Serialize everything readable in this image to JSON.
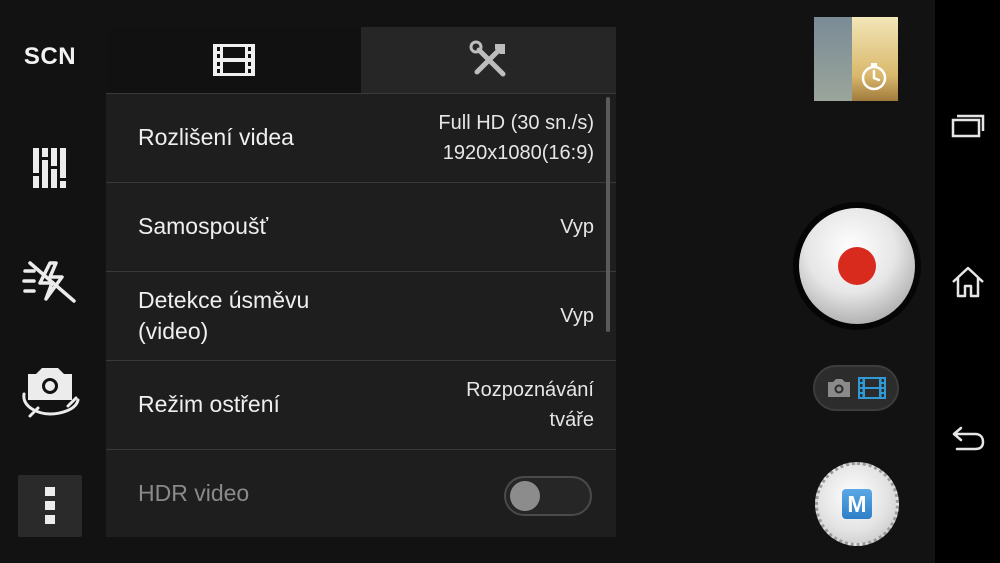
{
  "left_rail": {
    "scene_label": "SCN",
    "items": [
      {
        "name": "scene-button",
        "icon": "scn-text"
      },
      {
        "name": "adjustments-button",
        "icon": "sliders-icon"
      },
      {
        "name": "flash-button",
        "icon": "flash-off-icon"
      },
      {
        "name": "switch-camera-button",
        "icon": "camera-switch-icon"
      },
      {
        "name": "more-options-button",
        "icon": "more-vertical-icon"
      }
    ]
  },
  "settings_panel": {
    "tabs": [
      {
        "name": "video-settings",
        "icon": "film-strip-icon",
        "active": true
      },
      {
        "name": "general-settings",
        "icon": "tools-icon",
        "active": false
      }
    ],
    "rows": [
      {
        "label": "Rozlišení videa",
        "value": "Full HD (30 sn./s)\n1920x1080(16:9)"
      },
      {
        "label": "Samospoušť",
        "value": "Vyp"
      },
      {
        "label": "Detekce úsměvu\n(video)",
        "value": "Vyp"
      },
      {
        "label": "Režim ostření",
        "value": "Rozpoznávání\ntváře"
      }
    ],
    "hdr": {
      "label": "HDR video",
      "enabled": false
    }
  },
  "right_controls": {
    "thumbnail_icon": "self-timer-icon",
    "record_button": {
      "icon": "record-icon",
      "color": "#d92a1e"
    },
    "mode_switch": {
      "camera_icon": "camera-icon",
      "video_icon": "video-icon",
      "active": "video",
      "active_color": "#2f9bd6"
    },
    "manual_button_label": "M"
  },
  "nav_bar": {
    "items": [
      {
        "name": "recent-apps-button",
        "icon": "recent-apps-icon"
      },
      {
        "name": "home-button",
        "icon": "home-icon"
      },
      {
        "name": "back-button",
        "icon": "back-icon"
      }
    ]
  },
  "colors": {
    "background": "#121212",
    "panel": "#1e1e1e",
    "accent": "#2f9bd6",
    "record": "#d92a1e"
  }
}
